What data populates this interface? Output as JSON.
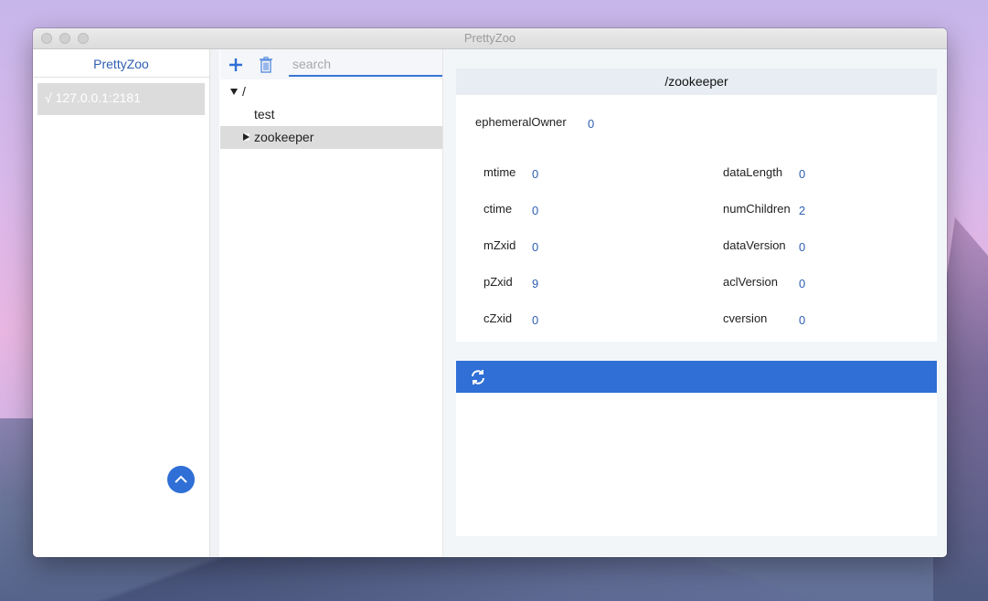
{
  "window": {
    "title": "PrettyZoo"
  },
  "sidebar": {
    "header": "PrettyZoo",
    "servers": [
      {
        "label": "√ 127.0.0.1:2181"
      }
    ]
  },
  "toolbar": {
    "search_placeholder": "search"
  },
  "tree": {
    "root": "/",
    "children": [
      {
        "label": "test"
      },
      {
        "label": "zookeeper"
      }
    ]
  },
  "detail": {
    "path": "/zookeeper",
    "ephemeralOwner": {
      "label": "ephemeralOwner",
      "value": "0"
    },
    "left": [
      {
        "label": "mtime",
        "value": "0"
      },
      {
        "label": "ctime",
        "value": "0"
      },
      {
        "label": "mZxid",
        "value": "0"
      },
      {
        "label": "pZxid",
        "value": "9"
      },
      {
        "label": "cZxid",
        "value": "0"
      }
    ],
    "right": [
      {
        "label": "dataLength",
        "value": "0"
      },
      {
        "label": "numChildren",
        "value": "2"
      },
      {
        "label": "dataVersion",
        "value": "0"
      },
      {
        "label": "aclVersion",
        "value": "0"
      },
      {
        "label": "cversion",
        "value": "0"
      }
    ]
  },
  "colors": {
    "accent": "#2f6fd6",
    "value": "#2f5fb3"
  },
  "icons": [
    "plus-icon",
    "trash-icon",
    "refresh-icon",
    "chevron-up-icon"
  ]
}
